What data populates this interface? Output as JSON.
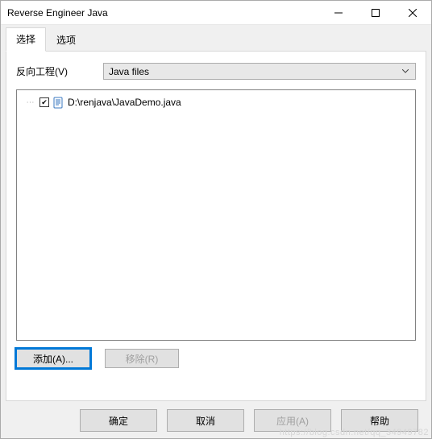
{
  "window": {
    "title": "Reverse Engineer Java"
  },
  "tabs": {
    "select": "选择",
    "options": "选项"
  },
  "panel": {
    "reverse_label": "反向工程(V)",
    "dropdown_value": "Java files"
  },
  "tree": {
    "item0": {
      "checked": true,
      "path": "D:\\renjava\\JavaDemo.java"
    }
  },
  "buttons": {
    "add": "添加(A)...",
    "remove": "移除(R)",
    "ok": "确定",
    "cancel": "取消",
    "apply": "应用(A)",
    "help": "帮助"
  },
  "watermark": "https://blog.csdn.net/qq_34949782"
}
